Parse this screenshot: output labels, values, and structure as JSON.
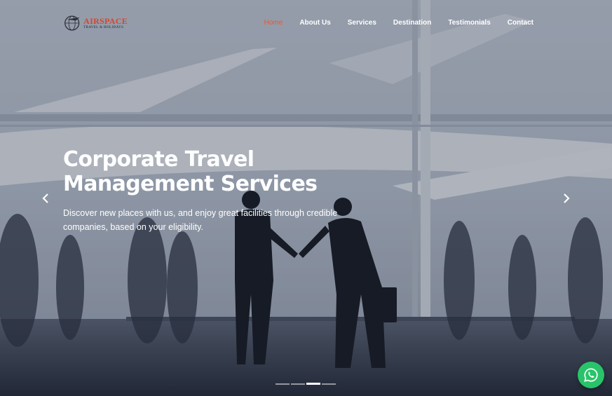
{
  "brand": {
    "name": "AIRSPACE",
    "tagline": "TRAVEL & HOLIDAYS",
    "colors": {
      "accent": "#d9442a",
      "nav_active": "#e8582f",
      "whatsapp": "#29c46a"
    }
  },
  "nav": {
    "items": [
      {
        "label": "Home",
        "active": true
      },
      {
        "label": "About Us",
        "active": false
      },
      {
        "label": "Services",
        "active": false
      },
      {
        "label": "Destination",
        "active": false
      },
      {
        "label": "Testimonials",
        "active": false
      },
      {
        "label": "Contact",
        "active": false
      }
    ]
  },
  "hero": {
    "headline_line1": "Corporate Travel",
    "headline_line2": "Management Services",
    "subtitle": "Discover new places with us, and enjoy great facilities through credible companies, based on your eligibility.",
    "slide_count": 4,
    "active_slide": 3
  },
  "icons": {
    "prev": "chevron-left-icon",
    "next": "chevron-right-icon",
    "whatsapp": "whatsapp-icon",
    "logo": "globe-plane-icon"
  }
}
